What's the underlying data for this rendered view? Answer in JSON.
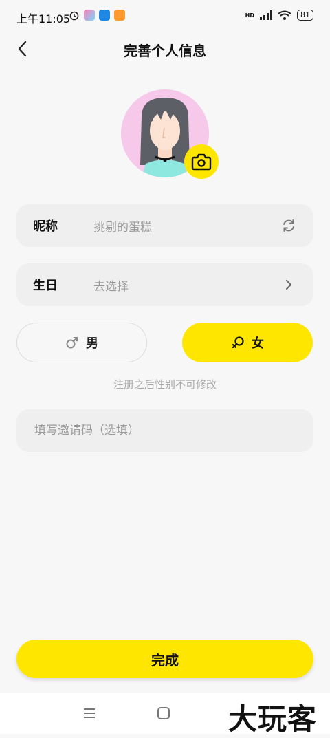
{
  "status_bar": {
    "time": "上午11:05",
    "network": "HD",
    "battery": "81"
  },
  "header": {
    "title": "完善个人信息",
    "back_icon": "chevron-left-icon"
  },
  "avatar": {
    "camera_icon": "camera-icon"
  },
  "nickname_row": {
    "label": "昵称",
    "value": "挑剔的蛋糕",
    "icon": "refresh-icon"
  },
  "birthday_row": {
    "label": "生日",
    "value": "去选择",
    "icon": "chevron-right-icon"
  },
  "gender": {
    "male_label": "男",
    "female_label": "女",
    "selected": "女",
    "hint": "注册之后性别不可修改"
  },
  "invite": {
    "placeholder": "填写邀请码（选填）",
    "value": ""
  },
  "done_label": "完成",
  "watermark": "大玩客",
  "colors": {
    "accent": "#ffe600",
    "background": "#f7f7f7",
    "row_bg": "#efefef"
  }
}
